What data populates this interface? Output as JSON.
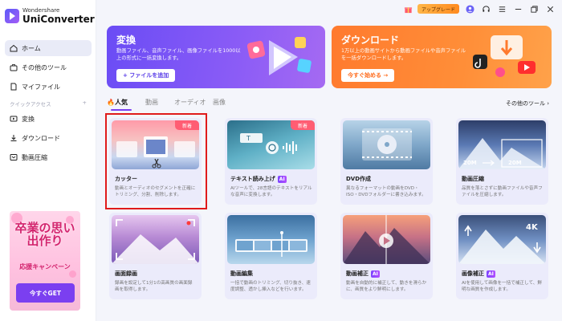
{
  "app": {
    "brand": "Wondershare",
    "product": "UniConverter"
  },
  "topbar": {
    "upgrade_label": "アップグレード"
  },
  "sidebar": {
    "nav": [
      {
        "label": "ホーム",
        "icon": "home-icon",
        "active": true
      },
      {
        "label": "その他のツール",
        "icon": "toolbox-icon",
        "active": false
      },
      {
        "label": "マイファイル",
        "icon": "file-icon",
        "active": false
      }
    ],
    "quick_access_label": "クイックアクセス",
    "quick_add": "+",
    "quick": [
      {
        "label": "変換",
        "icon": "convert-icon"
      },
      {
        "label": "ダウンロード",
        "icon": "download-icon"
      },
      {
        "label": "動画圧縮",
        "icon": "compress-icon"
      }
    ],
    "promo": {
      "title": "卒業の思い出作り",
      "subtitle": "応援キャンペーン",
      "button": "今すぐGET"
    }
  },
  "banners": {
    "convert": {
      "title": "変換",
      "desc": "動画ファイル、音声ファイル、画像ファイルを1000以上の形式に一括変換します。",
      "button": "+ ファイルを追加"
    },
    "download": {
      "title": "ダウンロード",
      "desc": "1万以上の動画サイトから動画ファイルや音声ファイルを一括ダウンロードします。",
      "button": "今すぐ始める →"
    }
  },
  "tabs": [
    "人気",
    "動画",
    "オーディオ",
    "画像"
  ],
  "other_tools_label": "その他のツール ›",
  "cards": [
    {
      "title": "カッター",
      "desc": "動画とオーディオのセグメントを正確にトリミング、分割、削除します。",
      "badge": "新着",
      "ai": false
    },
    {
      "title": "テキスト読み上げ",
      "desc": "AIツールで、28言語のテキストをリアルな音声に変換します。",
      "badge": "新着",
      "ai": true
    },
    {
      "title": "DVD作成",
      "desc": "異なるフォーマットの動画をDVD・ISO・DVDフォルダーに書き込みます。",
      "badge": "",
      "ai": false
    },
    {
      "title": "動画圧縮",
      "desc": "品質を落とさずに動画ファイルや音声ファイルを圧縮します。",
      "badge": "",
      "ai": false
    },
    {
      "title": "画面録画",
      "desc": "録画を設定して1分1の高画質の画面録画を取得します。",
      "badge": "",
      "ai": false
    },
    {
      "title": "動画編集",
      "desc": "一括で動画のトリミング、切り抜き、速度調整、透かし挿入などを行います。",
      "badge": "",
      "ai": false
    },
    {
      "title": "動画補正",
      "desc": "動画を自動的に補正して、動きを滑らかに、画質をより鮮明にします。",
      "badge": "",
      "ai": true
    },
    {
      "title": "画像補正",
      "desc": "AIを使用して画像を一括で補正して、鮮明な画質を作成します。",
      "badge": "",
      "ai": true
    }
  ],
  "card_art_labels": {
    "compress_before": "20M",
    "compress_after": "20M",
    "upscale": "4K",
    "tts_t": "T"
  },
  "ai_label": "AI",
  "colors": {
    "accent": "#7b3ff0",
    "highlight": "#e01b1b",
    "new_badge": "#ff5d73"
  }
}
